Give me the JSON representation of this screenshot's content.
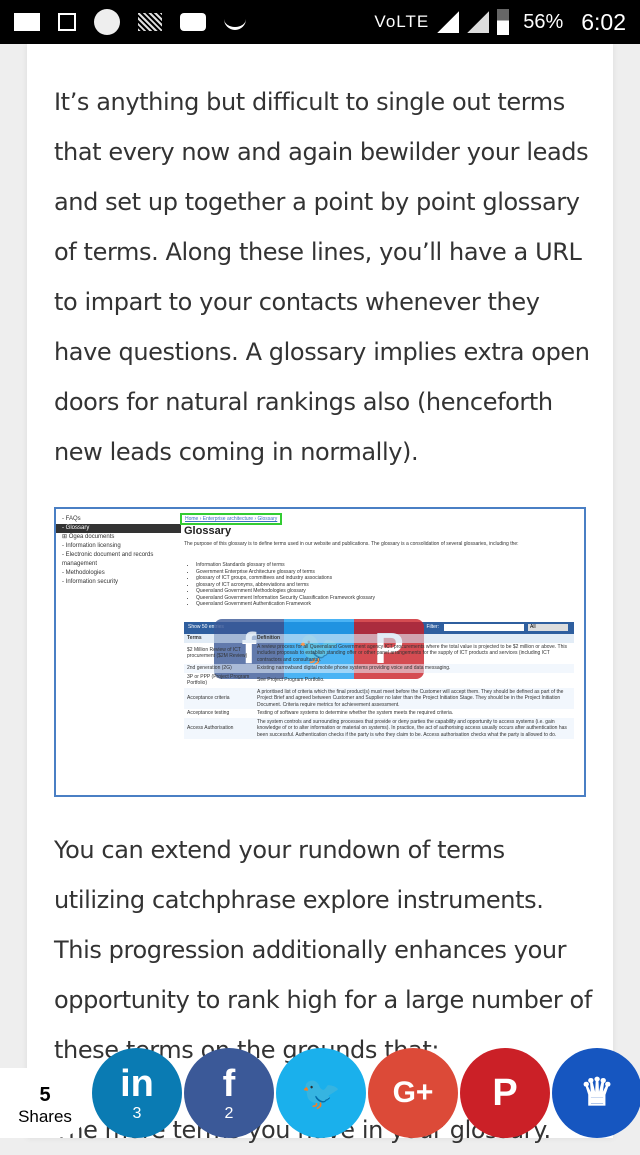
{
  "status_bar": {
    "network": "VoLTE",
    "battery": "56%",
    "time": "6:02",
    "icons": [
      "mail-icon",
      "image-icon",
      "circle-icon",
      "stripe-icon",
      "youtube-icon",
      "smile-icon",
      "signal-icon",
      "battery-icon"
    ]
  },
  "article": {
    "paragraph1": "It’s anything but difficult to single out terms that every now and again bewilder your leads and set up together a point by point glossary of terms. Along these lines, you’ll have a URL to impart to your contacts whenever they have questions. A glossary implies extra open doors for natural rankings also (henceforth new leads coming in normally).",
    "paragraph2": "You can extend your rundown of terms utilizing catchphrase explore instruments. This progression additionally enhances your opportunity to rank high for a large number of these terms on the grounds that:",
    "paragraph3": "The more terms you have in your glossary."
  },
  "screenshot": {
    "side": [
      "- FAQs",
      "- Glossary",
      "⊞ Ogea documents",
      "- Information licensing",
      "- Electronic document and records management",
      "- Methodologies",
      "- Information security"
    ],
    "breadcrumb": "Home › Enterprise architecture › Glossary",
    "title": "Glossary",
    "desc": "The purpose of this glossary is to define terms used in our website and publications. The glossary is a consolidation of several glossaries, including the:",
    "list": [
      "Information Standards glossary of terms",
      "Government Enterprise Architecture glossary of terms",
      "glossary of ICT groups, committees and industry associations",
      "glossary of ICT acronyms, abbreviations and terms",
      "Queensland Government Methodologies glossary",
      "Queensland Government Information Security Classification Framework glossary",
      "Queensland Government Authentication Framework"
    ],
    "show": "Show 50 entries",
    "filter": "Filter:",
    "filter_select": "All",
    "headers": [
      "Terms",
      "Definition"
    ],
    "rows": [
      [
        "$2 Million Review of ICT procurement ($2M Review)",
        "A review process for all Queensland Government agency ICT procurements where the total value is projected to be $2 million or above. This includes proposals to establish standing offer or other panel arrangements for the supply of ICT products and services (including ICT contractors and consultants)."
      ],
      [
        "2nd generation (2G)",
        "Existing narrowband digital mobile phone systems providing voice and data messaging."
      ],
      [
        "3P or PPP (Project Program Portfolio)",
        "See Project Program Portfolio."
      ],
      [
        "Acceptance criteria",
        "A prioritised list of criteria which the final product(s) must meet before the Customer will accept them. They should be defined as part of the Project Brief and agreed between Customer and Supplier no later than the Project Initiation Stage. They should be in the Project Initiation Document. Criteria require metrics for achievement assessment."
      ],
      [
        "Acceptance testing",
        "Testing of software systems to determine whether the system meets the required criteria."
      ],
      [
        "Access Authorisation",
        "The system controls and surrounding processes that provide or deny parties the capability and opportunity to access systems (i.e. gain knowledge of or to alter information or material on systems). In practice, the act of authorising access usually occurs after authentication has been successful. Authentication checks if the party is who they claim to be. Access authorisation checks what the party is allowed to do."
      ]
    ],
    "overlay": [
      {
        "glyph": "f",
        "color": "#3b5998"
      },
      {
        "glyph": "🐦",
        "color": "#1da1f2"
      },
      {
        "glyph": "P",
        "color": "#cb2027"
      }
    ]
  },
  "share_bar": {
    "count": "5",
    "label": "Shares",
    "buttons": [
      {
        "name": "linkedin",
        "glyph": "in",
        "count": "3",
        "color": "#0a7bb3"
      },
      {
        "name": "facebook",
        "glyph": "f",
        "count": "2",
        "color": "#3b5998"
      },
      {
        "name": "twitter",
        "glyph": "🐦",
        "count": "",
        "color": "#1ab0ec"
      },
      {
        "name": "google-plus",
        "glyph": "G+",
        "count": "",
        "color": "#dc4a38"
      },
      {
        "name": "pinterest",
        "glyph": "P",
        "count": "",
        "color": "#cb2027"
      },
      {
        "name": "more",
        "glyph": "♛",
        "count": "",
        "color": "#1656c0"
      }
    ]
  }
}
